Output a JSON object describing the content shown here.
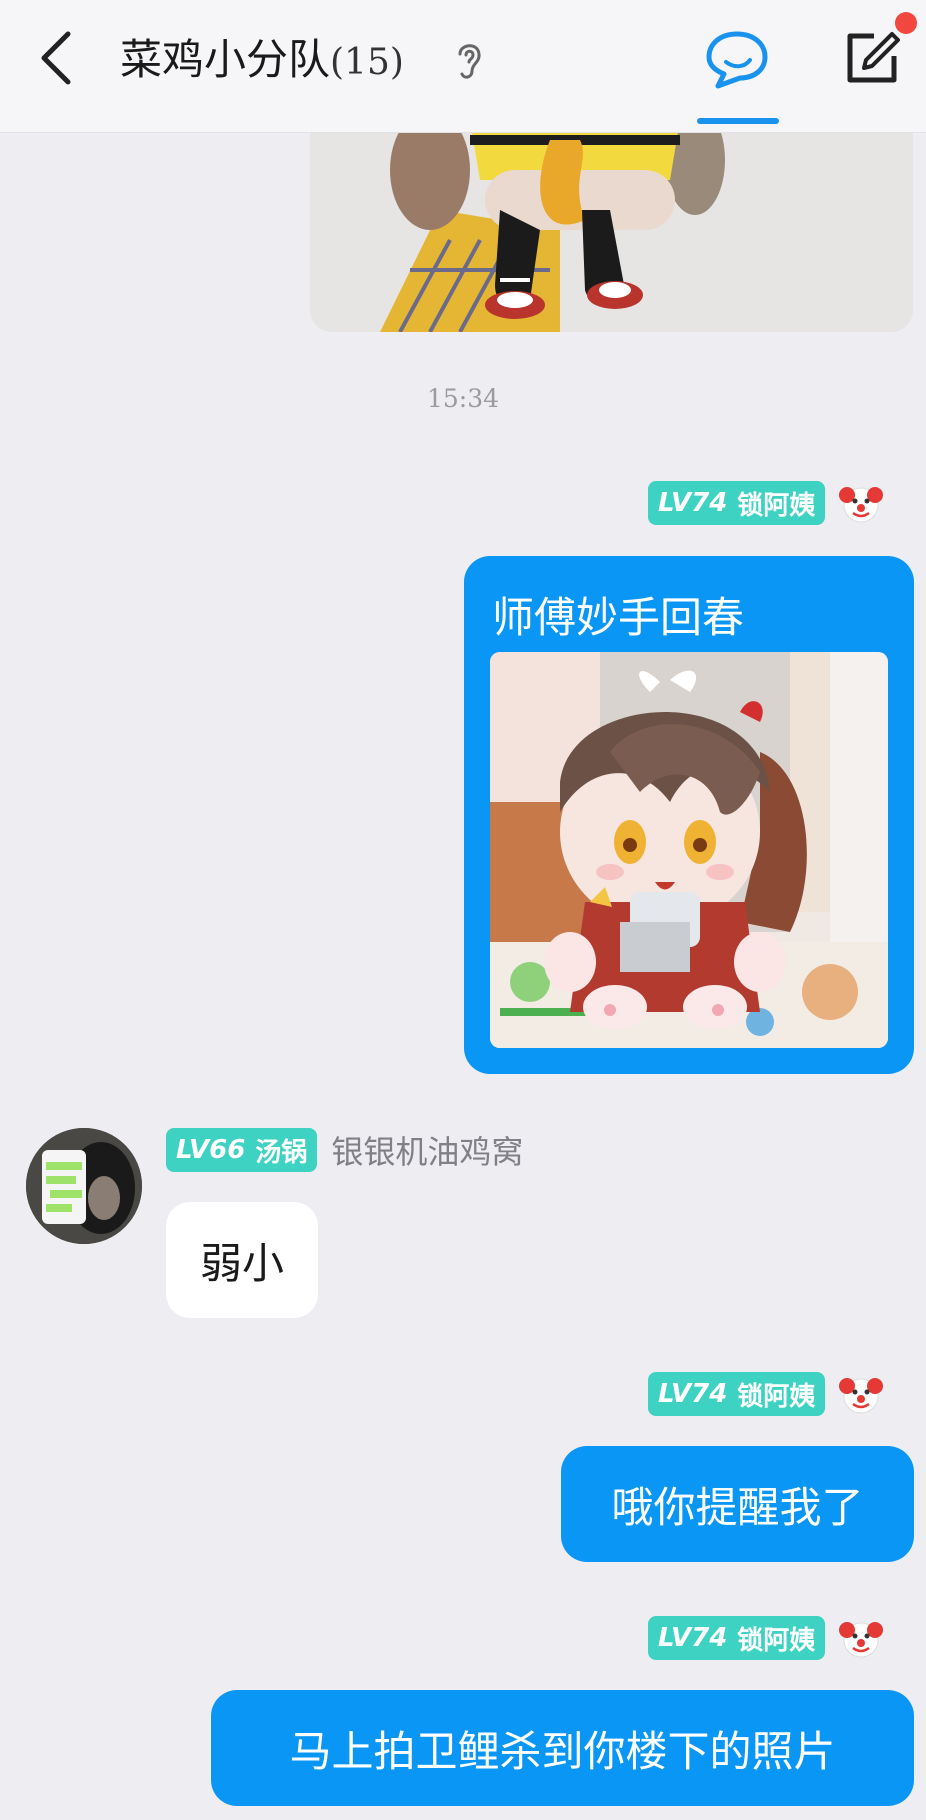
{
  "header": {
    "title": "菜鸡小分队",
    "member_count": "(15)"
  },
  "chat": {
    "time_label": "15:34",
    "messages": [
      {
        "level": "LV74",
        "sender": "锁阿姨",
        "text": "师傅妙手回春"
      },
      {
        "level": "LV66",
        "sender": "汤锅",
        "sender_title": "银银机油鸡窝",
        "text": "弱小"
      },
      {
        "level": "LV74",
        "sender": "锁阿姨",
        "text": "哦你提醒我了"
      },
      {
        "level": "LV74",
        "sender": "锁阿姨",
        "text": "马上拍卫鲤杀到你楼下的照片"
      }
    ]
  },
  "colors": {
    "accent_blue": "#0a96f5",
    "badge_teal": "#3ed2c3",
    "notification_red": "#f2473f",
    "background": "#ededf2"
  },
  "icons": {
    "back": "chevron-left-icon",
    "listen": "ear-icon",
    "chat_tab": "chat-bubble-icon",
    "compose": "compose-icon",
    "sender_emoji": "clown-face-icon"
  }
}
